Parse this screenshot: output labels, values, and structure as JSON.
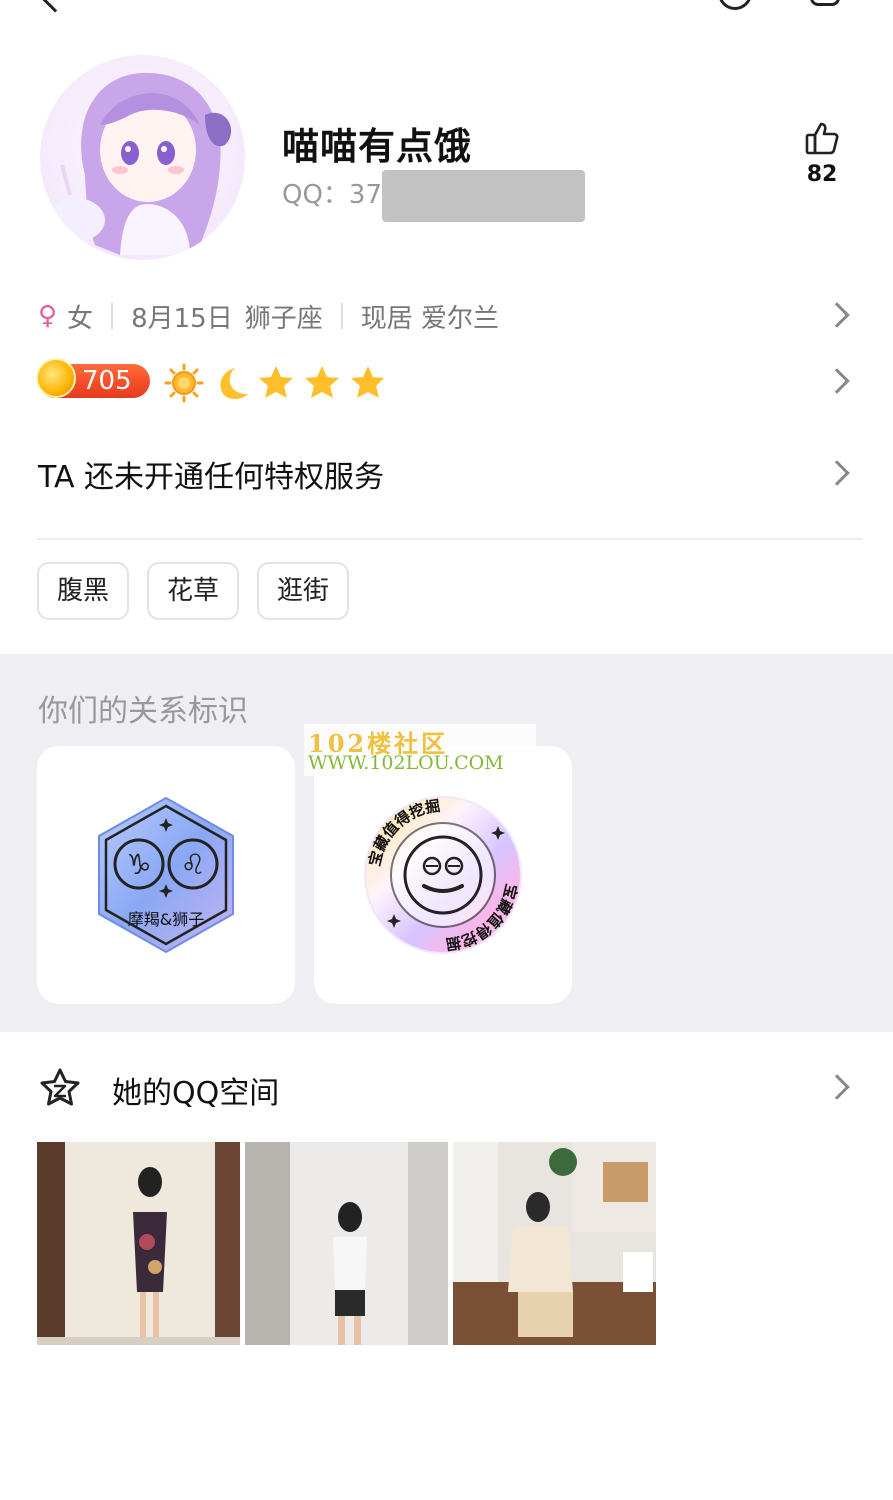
{
  "profile": {
    "nickname": "喵喵有点饿",
    "qq_label": "QQ：37",
    "likes": "82"
  },
  "info": {
    "gender_icon": "female-icon",
    "gender": "女",
    "birthday": "8月15日",
    "zodiac": "狮子座",
    "location": "现居 爱尔兰"
  },
  "level": {
    "value": "705",
    "icons": [
      "sun-icon",
      "moon-icon",
      "star-icon",
      "star-icon",
      "star-icon"
    ]
  },
  "privilege": "TA 还未开通任何特权服务",
  "tags": [
    "腹黑",
    "花草",
    "逛街"
  ],
  "relation": {
    "title": "你们的关系标识",
    "badges": [
      {
        "name": "constellation-badge",
        "label": "摩羯&狮子"
      },
      {
        "name": "treasure-badge",
        "label": "宝藏值得挖掘"
      }
    ],
    "watermark_line1": "102楼社区",
    "watermark_line2": "WWW.102LOU.COM"
  },
  "qzone": {
    "title": "她的QQ空间",
    "icon": "qzone-star-icon"
  },
  "colors": {
    "accent_female": "#e55ca5",
    "level_badge": "#e83a1e",
    "section_bg": "#efeff3"
  }
}
